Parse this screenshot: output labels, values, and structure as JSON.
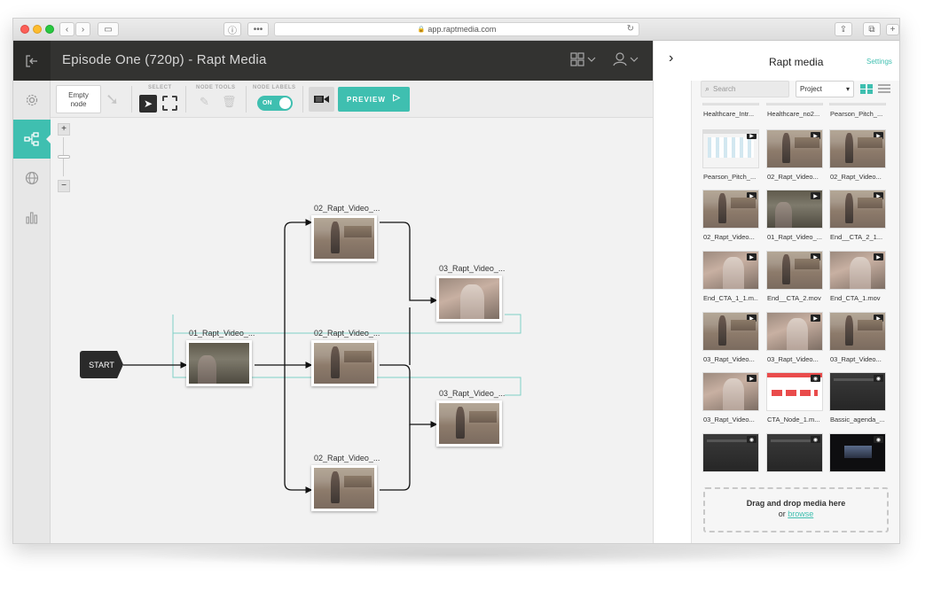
{
  "browser": {
    "url": "app.raptmedia.com"
  },
  "header": {
    "title": "Episode One (720p) - Rapt Media"
  },
  "toolbar": {
    "empty_node_label": "Empty node",
    "select_label": "SELECT",
    "node_tools_label": "NODE TOOLS",
    "node_labels_label": "NODE LABELS",
    "toggle_state": "ON",
    "preview_label": "PREVIEW"
  },
  "canvas": {
    "start_label": "START",
    "nodes": [
      {
        "label": "01_Rapt_Video_...",
        "thumb": "forest"
      },
      {
        "label": "02_Rapt_Video_...",
        "thumb": "street"
      },
      {
        "label": "02_Rapt_Video_...",
        "thumb": "street"
      },
      {
        "label": "02_Rapt_Video_...",
        "thumb": "street"
      },
      {
        "label": "03_Rapt_Video_...",
        "thumb": "crowd"
      },
      {
        "label": "03_Rapt_Video_...",
        "thumb": "street"
      }
    ]
  },
  "panel": {
    "title": "Rapt media",
    "settings_label": "Settings",
    "search_placeholder": "Search",
    "project_select_value": "Project",
    "media": [
      {
        "caption": "Healthcare_Intr...",
        "thumb": "partial",
        "badge": ""
      },
      {
        "caption": "Healthcare_no2...",
        "thumb": "partial",
        "badge": ""
      },
      {
        "caption": "Pearson_Pitch_...",
        "thumb": "partial",
        "badge": ""
      },
      {
        "caption": "Pearson_Pitch_...",
        "thumb": "ui",
        "badge": "video"
      },
      {
        "caption": "02_Rapt_Video...",
        "thumb": "street",
        "badge": "video"
      },
      {
        "caption": "02_Rapt_Video...",
        "thumb": "street",
        "badge": "video"
      },
      {
        "caption": "02_Rapt_Video...",
        "thumb": "street",
        "badge": "video"
      },
      {
        "caption": "01_Rapt_Video_...",
        "thumb": "forest",
        "badge": "video"
      },
      {
        "caption": "End__CTA_2_1...",
        "thumb": "street",
        "badge": "video"
      },
      {
        "caption": "End_CTA_1_1.m...",
        "thumb": "crowd",
        "badge": "video"
      },
      {
        "caption": "End__CTA_2.mov",
        "thumb": "street",
        "badge": "video"
      },
      {
        "caption": "End_CTA_1.mov",
        "thumb": "crowd",
        "badge": "video"
      },
      {
        "caption": "03_Rapt_Video...",
        "thumb": "street",
        "badge": "video"
      },
      {
        "caption": "03_Rapt_Video...",
        "thumb": "crowd",
        "badge": "video"
      },
      {
        "caption": "03_Rapt_Video...",
        "thumb": "street",
        "badge": "video"
      },
      {
        "caption": "03_Rapt_Video...",
        "thumb": "crowd",
        "badge": "video"
      },
      {
        "caption": "CTA_Node_1.m...",
        "thumb": "cta",
        "badge": "camera"
      },
      {
        "caption": "Bassic_agenda_...",
        "thumb": "dark",
        "badge": "camera"
      },
      {
        "caption": "",
        "thumb": "dark",
        "badge": "camera"
      },
      {
        "caption": "",
        "thumb": "dark",
        "badge": "camera"
      },
      {
        "caption": "",
        "thumb": "black",
        "badge": "camera"
      }
    ],
    "dropzone_title": "Drag and drop media here",
    "dropzone_or": "or",
    "dropzone_link": "browse"
  },
  "icons": {
    "exit": "exit-icon",
    "grid": "apps-grid-icon",
    "user": "user-icon",
    "settings": "gear-icon",
    "story": "story-graph-icon",
    "globe": "globe-icon",
    "analytics": "bar-chart-icon"
  },
  "colors": {
    "accent": "#3fbfb0",
    "header_bg": "#333331",
    "start_node": "#2a2a2a"
  }
}
